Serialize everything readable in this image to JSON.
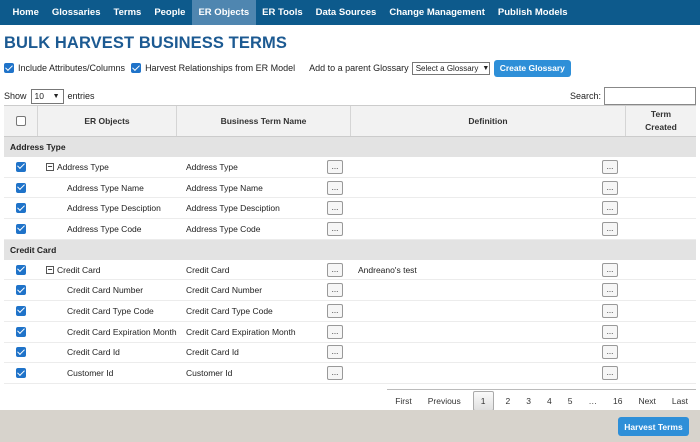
{
  "nav": [
    "Home",
    "Glossaries",
    "Terms",
    "People",
    "ER Objects",
    "ER Tools",
    "Data Sources",
    "Change Management",
    "Publish Models"
  ],
  "nav_active": "ER Objects",
  "page_title": "BULK HARVEST BUSINESS TERMS",
  "options": {
    "include_attributes": "Include Attributes/Columns",
    "harvest_relationships": "Harvest Relationships from ER Model",
    "parent_glossary_label": "Add to a parent Glossary",
    "glossary_select": "Select a Glossary",
    "create_glossary": "Create Glossary"
  },
  "length": {
    "show": "Show",
    "value": "10",
    "entries": "entries"
  },
  "search": {
    "label": "Search:"
  },
  "table": {
    "headers": {
      "er_objects": "ER Objects",
      "business_term": "Business Term Name",
      "definition": "Definition",
      "created_1": "Term",
      "created_2": "Created"
    },
    "groups": [
      {
        "name": "Address Type",
        "rows": [
          {
            "er": "Address Type",
            "term": "Address Type",
            "def": "",
            "parent": true
          },
          {
            "er": "Address Type Name",
            "term": "Address Type Name",
            "def": "",
            "parent": false
          },
          {
            "er": "Address Type Desciption",
            "term": "Address Type Desciption",
            "def": "",
            "parent": false
          },
          {
            "er": "Address Type Code",
            "term": "Address Type Code",
            "def": "",
            "parent": false
          }
        ]
      },
      {
        "name": "Credit Card",
        "rows": [
          {
            "er": "Credit Card",
            "term": "Credit Card",
            "def": "Andreano's test",
            "parent": true
          },
          {
            "er": "Credit Card Number",
            "term": "Credit Card Number",
            "def": "",
            "parent": false
          },
          {
            "er": "Credit Card Type Code",
            "term": "Credit Card Type Code",
            "def": "",
            "parent": false
          },
          {
            "er": "Credit Card Expiration Month",
            "term": "Credit Card Expiration Month",
            "def": "",
            "parent": false
          },
          {
            "er": "Credit Card Id",
            "term": "Credit Card Id",
            "def": "",
            "parent": false
          },
          {
            "er": "Customer Id",
            "term": "Customer Id",
            "def": "",
            "parent": false
          }
        ]
      }
    ],
    "ellipsis": "...",
    "toggle_symbol": "−"
  },
  "pagination": {
    "first": "First",
    "previous": "Previous",
    "pages": [
      "1",
      "2",
      "3",
      "4",
      "5",
      "…",
      "16"
    ],
    "current": "1",
    "next": "Next",
    "last": "Last"
  },
  "footer": {
    "harvest": "Harvest Terms"
  },
  "colors": {
    "nav_bg": "#0d5a8c",
    "nav_active": "#4f86b0",
    "title": "#1c5a92",
    "button": "#2e8fd8",
    "checkbox": "#1f73c9"
  }
}
